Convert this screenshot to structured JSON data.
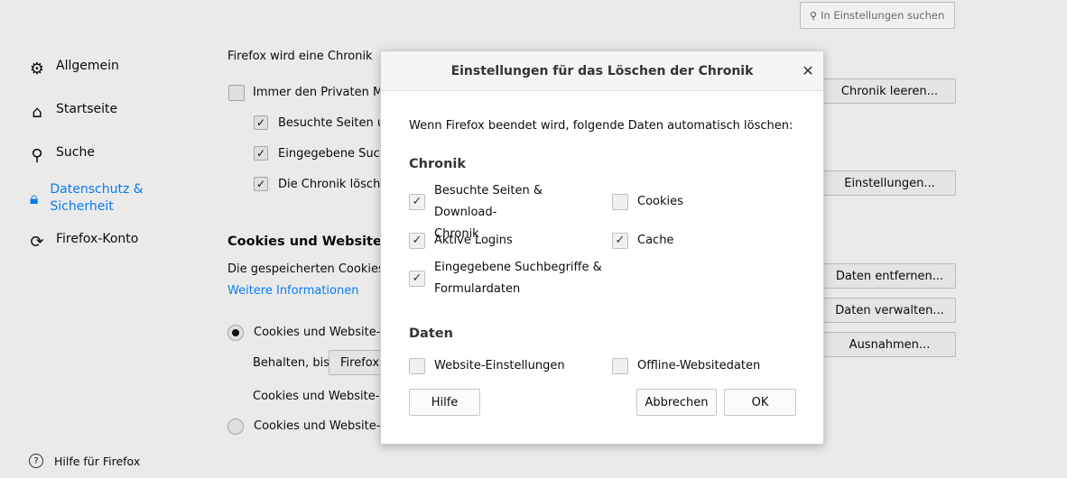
{
  "search": {
    "placeholder": "In Einstellungen suchen"
  },
  "sidebar": {
    "items": [
      {
        "label": "Allgemein",
        "icon": "gear-icon"
      },
      {
        "label": "Startseite",
        "icon": "home-icon"
      },
      {
        "label": "Suche",
        "icon": "search-icon"
      },
      {
        "label": "Datenschutz & Sicherheit",
        "icon": "lock-icon",
        "selected": true
      },
      {
        "label": "Firefox-Konto",
        "icon": "sync-icon"
      }
    ],
    "help": "Hilfe für Firefox"
  },
  "background": {
    "history_line": "Firefox wird eine Chronik",
    "private_mode": "Immer den Privaten Mo",
    "visited": "Besuchte Seiten un",
    "entered": "Eingegebene Such",
    "clear_history": "Die Chronik löscher",
    "clear_history_btn": "Chronik leeren...",
    "settings_btn": "Einstellungen...",
    "cookies_heading": "Cookies und Websited",
    "cookies_desc": "Die gespeicherten Cookies, W",
    "more_info": "Weitere Informationen",
    "remove_data_btn": "Daten entfernen...",
    "manage_data_btn": "Daten verwalten...",
    "exceptions_btn": "Ausnahmen...",
    "accept_cookies": "Cookies und Website-Da",
    "keep_until": "Behalten, bis",
    "keep_select": "Firefox",
    "third_party": "Cookies und Website-Da",
    "block_cookies": "Cookies und Website-Da"
  },
  "dialog": {
    "title": "Einstellungen für das Löschen der Chronik",
    "intro": "Wenn Firefox beendet wird, folgende Daten automatisch löschen:",
    "history_heading": "Chronik",
    "data_heading": "Daten",
    "options": {
      "visited_line1": "Besuchte Seiten & Download-",
      "visited_line2": "Chronik",
      "cookies": "Cookies",
      "logins": "Aktive Logins",
      "cache": "Cache",
      "form_line1": "Eingegebene Suchbegriffe &",
      "form_line2": "Formulardaten",
      "site_settings": "Website-Einstellungen",
      "offline": "Offline-Websitedaten"
    },
    "checked": {
      "visited": true,
      "cookies": false,
      "logins": true,
      "cache": true,
      "form": true,
      "site_settings": false,
      "offline": false
    },
    "buttons": {
      "help": "Hilfe",
      "cancel": "Abbrechen",
      "ok": "OK"
    }
  }
}
